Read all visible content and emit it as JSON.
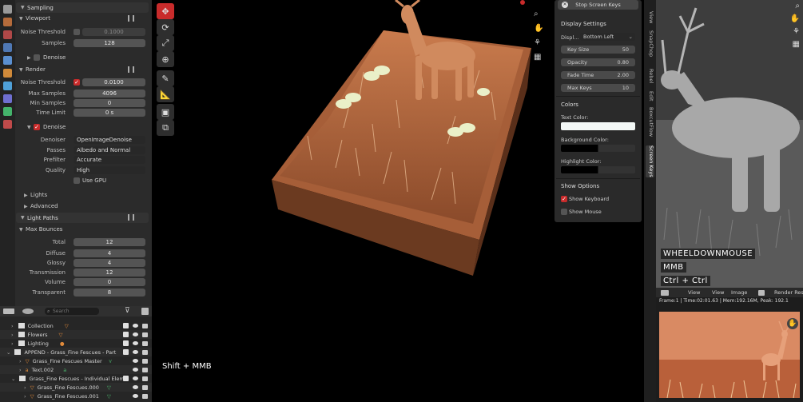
{
  "props": {
    "sampling_title": "Sampling",
    "viewport_title": "Viewport",
    "viewport_noise_label": "Noise Threshold",
    "viewport_noise_value": "0.1000",
    "viewport_samples_label": "Samples",
    "viewport_samples_value": "128",
    "viewport_denoise_label": "Denoise",
    "render_title": "Render",
    "render_noise_label": "Noise Threshold",
    "render_noise_value": "0.0100",
    "max_samples_label": "Max Samples",
    "max_samples_value": "4096",
    "min_samples_label": "Min Samples",
    "min_samples_value": "0",
    "time_limit_label": "Time Limit",
    "time_limit_value": "0 s",
    "render_denoise_label": "Denoise",
    "denoiser_label": "Denoiser",
    "denoiser_value": "OpenImageDenoise",
    "passes_label": "Passes",
    "passes_value": "Albedo and Normal",
    "prefilter_label": "Prefilter",
    "prefilter_value": "Accurate",
    "quality_label": "Quality",
    "quality_value": "High",
    "use_gpu_label": "Use GPU",
    "lights_title": "Lights",
    "advanced_title": "Advanced",
    "light_paths_title": "Light Paths",
    "max_bounces_title": "Max Bounces",
    "total_label": "Total",
    "total_value": "12",
    "diffuse_label": "Diffuse",
    "diffuse_value": "4",
    "glossy_label": "Glossy",
    "glossy_value": "4",
    "transmission_label": "Transmission",
    "transmission_value": "12",
    "volume_label": "Volume",
    "volume_value": "0",
    "transparent_label": "Transparent",
    "transparent_value": "8"
  },
  "outliner": {
    "search_placeholder": "Search",
    "rows": [
      {
        "label": "Collection"
      },
      {
        "label": "Flowers"
      },
      {
        "label": "Lighting"
      },
      {
        "label": "APPEND - Grass_Fine Fescues - Part"
      },
      {
        "label": "Grass_Fine Fescues Master"
      },
      {
        "label": "Text.002"
      },
      {
        "label": "Grass_Fine Fescues - Individual Elem"
      },
      {
        "label": "Grass_Fine Fescues.000"
      },
      {
        "label": "Grass_Fine Fescues.001"
      }
    ]
  },
  "viewport": {
    "key_overlay": "Shift + MMB"
  },
  "screencast": {
    "stop_button": "Stop Screen Keys",
    "display_settings_title": "Display Settings",
    "display_label": "Displ...",
    "display_value": "Bottom Left",
    "key_size_label": "Key Size",
    "key_size_value": "50",
    "opacity_label": "Opacity",
    "opacity_value": "0.80",
    "fade_time_label": "Fade Time",
    "fade_time_value": "2.00",
    "max_keys_label": "Max Keys",
    "max_keys_value": "10",
    "colors_title": "Colors",
    "text_color_label": "Text Color:",
    "bg_color_label": "Background Color:",
    "highlight_color_label": "Highlight Color:",
    "show_options_title": "Show Options",
    "show_keyboard_label": "Show Keyboard",
    "show_mouse_label": "Show Mouse"
  },
  "sidetabs": [
    "View",
    "SnapChop",
    "Rebel",
    "Edit",
    "BoxcutFlow",
    "Screen Keys"
  ],
  "right": {
    "key1": "WHEELDOWNMOUSE",
    "key2": "MMB",
    "key3": "Ctrl + Ctrl",
    "menu_view": "View",
    "menu_view2": "View",
    "menu_image": "Image",
    "render_result": "Render Res",
    "status": "Frame:1 | Time:02:01.63 | Mem:192.16M, Peak: 192.1"
  },
  "colors": {
    "accent_red": "#c82b2b",
    "panel_bg": "#2b2b2b",
    "field_bg": "#545454"
  }
}
